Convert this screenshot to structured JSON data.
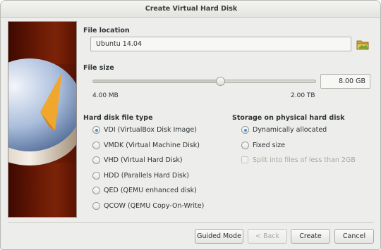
{
  "window": {
    "title": "Create Virtual Hard Disk"
  },
  "file_location": {
    "label": "File location",
    "value": "Ubuntu 14.04",
    "browse_icon": "folder-icon"
  },
  "file_size": {
    "label": "File size",
    "value": "8.00 GB",
    "min_label": "4.00 MB",
    "max_label": "2.00 TB",
    "slider_fraction": 0.57
  },
  "disk_type": {
    "heading": "Hard disk file type",
    "options": [
      {
        "label": "VDI (VirtualBox Disk Image)",
        "checked": true
      },
      {
        "label": "VMDK (Virtual Machine Disk)",
        "checked": false
      },
      {
        "label": "VHD (Virtual Hard Disk)",
        "checked": false
      },
      {
        "label": "HDD (Parallels Hard Disk)",
        "checked": false
      },
      {
        "label": "QED (QEMU enhanced disk)",
        "checked": false
      },
      {
        "label": "QCOW (QEMU Copy-On-Write)",
        "checked": false
      }
    ]
  },
  "storage": {
    "heading": "Storage on physical hard disk",
    "options": [
      {
        "label": "Dynamically allocated",
        "checked": true
      },
      {
        "label": "Fixed size",
        "checked": false
      }
    ],
    "split_label": "Split into files of less than 2GB",
    "split_enabled": false
  },
  "buttons": {
    "guided": "Guided Mode",
    "back": "< Back",
    "create": "Create",
    "cancel": "Cancel"
  },
  "colors": {
    "accent": "#4a90d9",
    "banner": "#6a1a05"
  }
}
